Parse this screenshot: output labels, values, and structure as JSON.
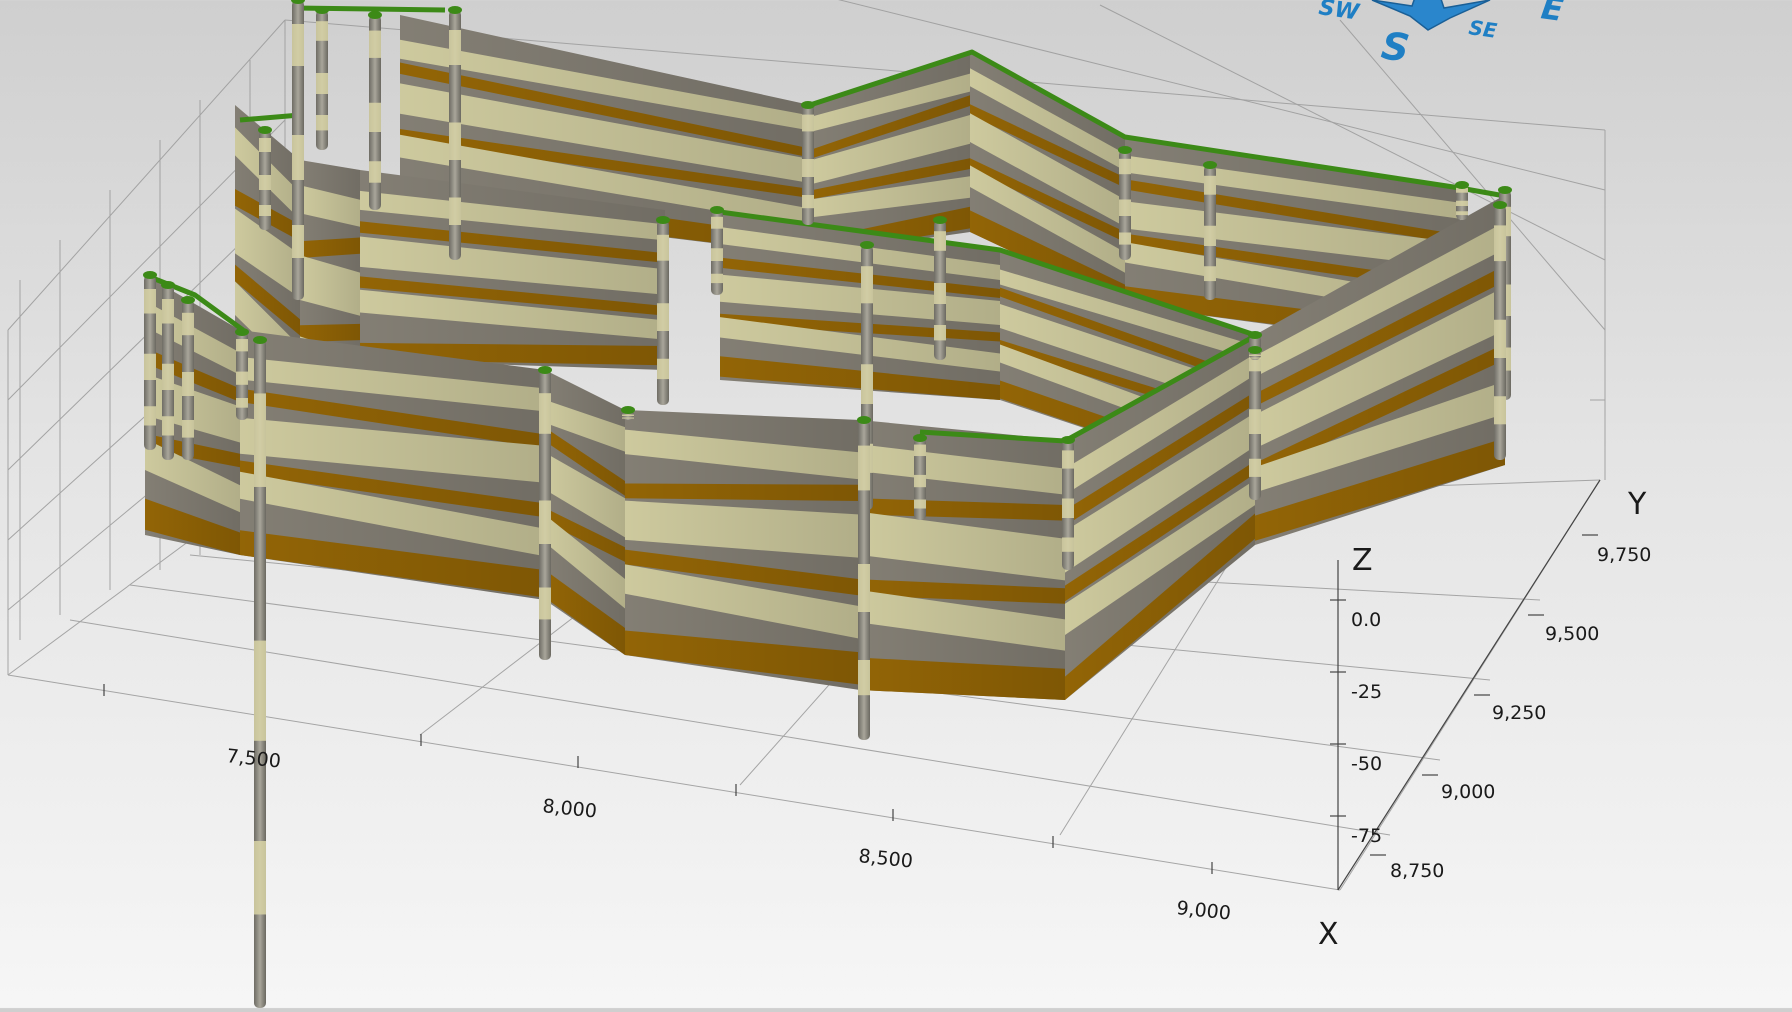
{
  "axes": {
    "x": {
      "name": "X",
      "ticks": [
        "7,500",
        "8,000",
        "8,500",
        "9,000"
      ]
    },
    "y": {
      "name": "Y",
      "ticks": [
        "8,750",
        "9,000",
        "9,250",
        "9,500",
        "9,750"
      ]
    },
    "z": {
      "name": "Z",
      "ticks": [
        "0.0",
        "-25",
        "-50",
        "-75"
      ]
    }
  },
  "compass": {
    "labels": [
      "SW",
      "S",
      "SE",
      "E"
    ],
    "color": "#1f7fc4"
  },
  "colors": {
    "clay": "#8a857a",
    "sand": "#d8d4a6",
    "gravel": "#9a6a06",
    "surface": "#3c8a17",
    "well": "#8f8c82"
  }
}
